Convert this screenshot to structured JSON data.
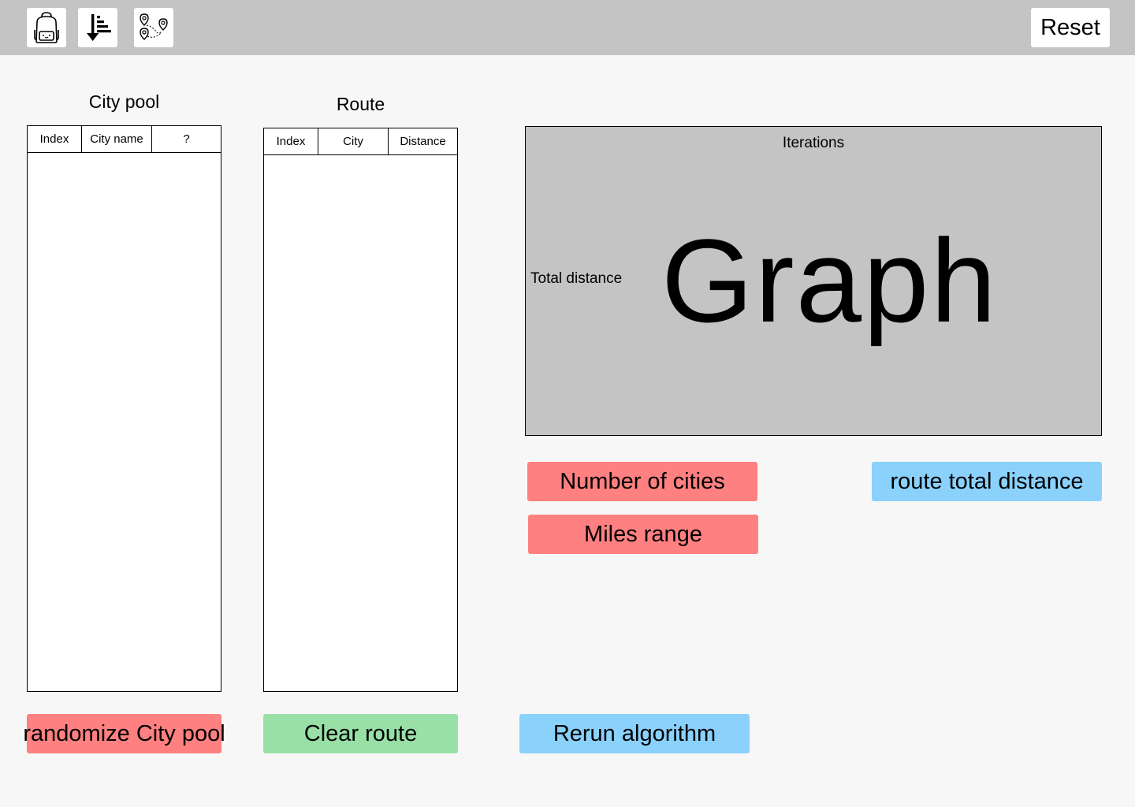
{
  "toolbar": {
    "icons": [
      "backpack-icon",
      "sort-descending-icon",
      "route-map-icon"
    ],
    "reset_label": "Reset"
  },
  "city_pool": {
    "title": "City pool",
    "columns": [
      "Index",
      "City name",
      "?"
    ]
  },
  "route": {
    "title": "Route",
    "columns": [
      "Index",
      "City",
      "Distance"
    ]
  },
  "graph": {
    "x_label": "Iterations",
    "y_label": "Total distance",
    "placeholder": "Graph"
  },
  "controls": {
    "number_of_cities": "Number of cities",
    "miles_range": "Miles range",
    "route_total_distance": "route total distance"
  },
  "actions": {
    "randomize": "randomize City pool",
    "clear_route": "Clear route",
    "rerun": "Rerun algorithm"
  },
  "colors": {
    "topbar": "#c4c4c4",
    "red_button": "#ff8080",
    "green_button": "#98e0a5",
    "blue_button": "#8ad1fc",
    "graph_bg": "#c4c4c4"
  }
}
